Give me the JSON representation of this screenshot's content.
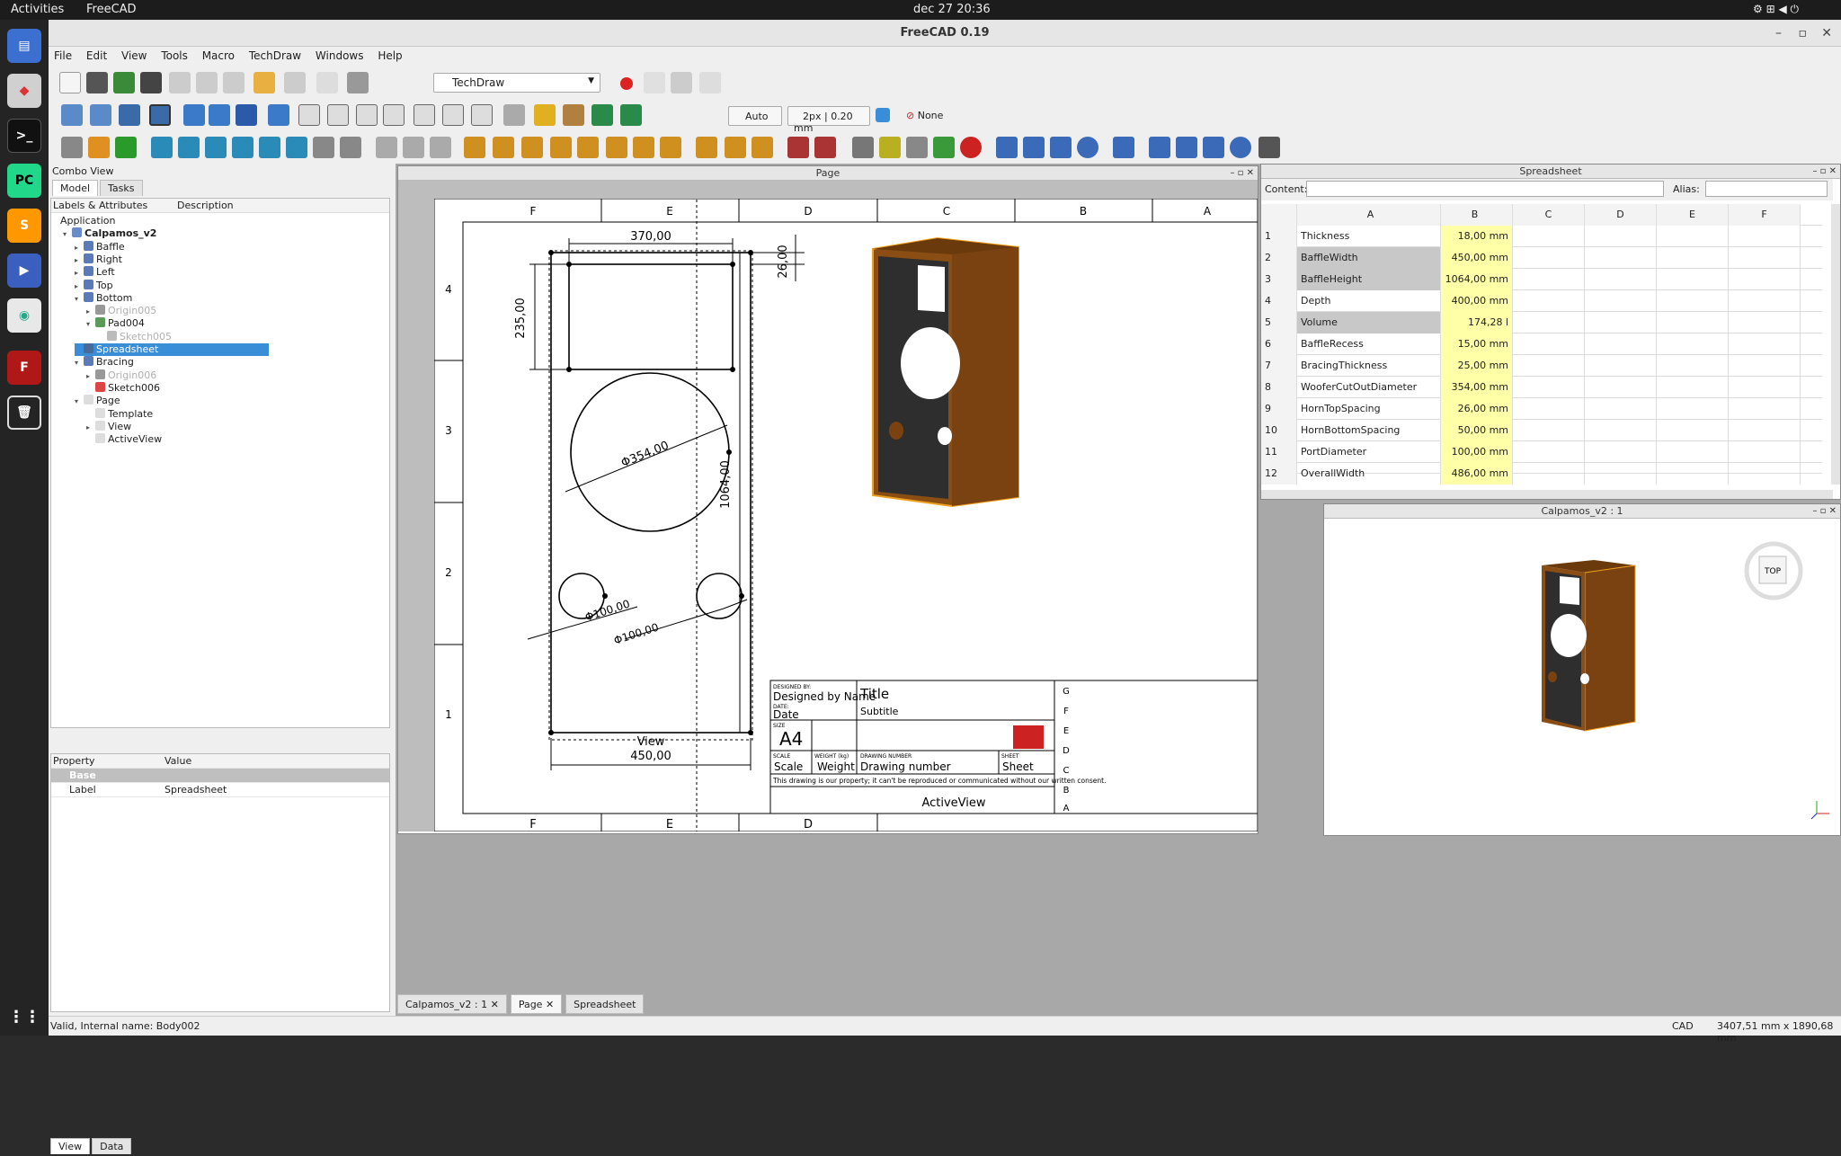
{
  "system": {
    "activities": "Activities",
    "app_name": "FreeCAD",
    "clock": "dec 27  20:36"
  },
  "window": {
    "title": "FreeCAD 0.19"
  },
  "menu": [
    "File",
    "Edit",
    "View",
    "Tools",
    "Macro",
    "TechDraw",
    "Windows",
    "Help"
  ],
  "toolbar": {
    "workbench": "TechDraw",
    "auto_label": "Auto",
    "line_width": "2px | 0.20 mm",
    "none_label": "None"
  },
  "combo": {
    "title": "Combo View",
    "tabs": [
      "Model",
      "Tasks"
    ],
    "columns": [
      "Labels & Attributes",
      "Description"
    ],
    "tree": [
      {
        "label": "Application",
        "level": 0,
        "arrow": "",
        "icon": "",
        "state": ""
      },
      {
        "label": "Calpamos_v2",
        "level": 1,
        "arrow": "▾",
        "icon": "#6a8ac8",
        "state": "bold"
      },
      {
        "label": "Baffle",
        "level": 2,
        "arrow": "▸",
        "icon": "#5a7ab8",
        "state": ""
      },
      {
        "label": "Right",
        "level": 2,
        "arrow": "▸",
        "icon": "#5a7ab8",
        "state": ""
      },
      {
        "label": "Left",
        "level": 2,
        "arrow": "▸",
        "icon": "#5a7ab8",
        "state": ""
      },
      {
        "label": "Top",
        "level": 2,
        "arrow": "▸",
        "icon": "#5a7ab8",
        "state": ""
      },
      {
        "label": "Bottom",
        "level": 2,
        "arrow": "▾",
        "icon": "#5a7ab8",
        "state": ""
      },
      {
        "label": "Origin005",
        "level": 3,
        "arrow": "▸",
        "icon": "#999",
        "state": "dim"
      },
      {
        "label": "Pad004",
        "level": 3,
        "arrow": "▾",
        "icon": "#5a9a5a",
        "state": ""
      },
      {
        "label": "Sketch005",
        "level": 4,
        "arrow": "",
        "icon": "#bbb",
        "state": "dim"
      },
      {
        "label": "Spreadsheet",
        "level": 2,
        "arrow": "",
        "icon": "#4a6a9a",
        "state": "sel"
      },
      {
        "label": "Bracing",
        "level": 2,
        "arrow": "▾",
        "icon": "#5a7ab8",
        "state": ""
      },
      {
        "label": "Origin006",
        "level": 3,
        "arrow": "▸",
        "icon": "#999",
        "state": "dim"
      },
      {
        "label": "Sketch006",
        "level": 3,
        "arrow": "",
        "icon": "#d44",
        "state": ""
      },
      {
        "label": "Page",
        "level": 2,
        "arrow": "▾",
        "icon": "#ddd",
        "state": ""
      },
      {
        "label": "Template",
        "level": 3,
        "arrow": "",
        "icon": "#ddd",
        "state": ""
      },
      {
        "label": "View",
        "level": 3,
        "arrow": "▸",
        "icon": "#ddd",
        "state": ""
      },
      {
        "label": "ActiveView",
        "level": 3,
        "arrow": "",
        "icon": "#ddd",
        "state": ""
      }
    ],
    "props_columns": [
      "Property",
      "Value"
    ],
    "props_group": "Base",
    "props": [
      {
        "name": "Label",
        "value": "Spreadsheet"
      }
    ],
    "bottom_tabs": [
      "View",
      "Data"
    ]
  },
  "page_window": {
    "title": "Page",
    "dims": {
      "top_width": "370,00",
      "height_235": "235,00",
      "top_offset": "26,00",
      "woofer": "Φ354,00",
      "height_total": "1064,00",
      "port1": "Φ100,00",
      "port2": "Φ100,00",
      "bottom_width": "450,00",
      "view_label": "View",
      "active_view": "ActiveView"
    },
    "zones_top": [
      "F",
      "E",
      "D",
      "C",
      "B",
      "A"
    ],
    "zones_side": [
      "4",
      "3",
      "2",
      "1"
    ],
    "title_block": {
      "designed_by_cap": "DESIGNED BY:",
      "designed_by": "Designed by Name",
      "date_cap": "DATE:",
      "date": "Date",
      "size_cap": "SIZE",
      "size": "A4",
      "title": "Title",
      "subtitle": "Subtitle",
      "scale_cap": "SCALE",
      "scale": "Scale",
      "weight_cap": "WEIGHT (kg)",
      "weight": "Weight",
      "drawing_cap": "DRAWING NUMBER",
      "drawing": "Drawing number",
      "sheet_cap": "SHEET",
      "sheet": "Sheet",
      "notice": "This drawing is our property; it can't be reproduced or communicated without our written consent.",
      "rows": [
        "G",
        "F",
        "E",
        "D",
        "C",
        "B",
        "A"
      ]
    }
  },
  "spreadsheet": {
    "title": "Spreadsheet",
    "content_label": "Content:",
    "alias_label": "Alias:",
    "columns": [
      "A",
      "B",
      "C",
      "D",
      "E",
      "F"
    ],
    "rows": [
      {
        "n": "1",
        "a": "Thickness",
        "b": "18,00 mm",
        "hl": false
      },
      {
        "n": "2",
        "a": "BaffleWidth",
        "b": "450,00 mm",
        "hl": true
      },
      {
        "n": "3",
        "a": "BaffleHeight",
        "b": "1064,00 mm",
        "hl": true
      },
      {
        "n": "4",
        "a": "Depth",
        "b": "400,00 mm",
        "hl": false
      },
      {
        "n": "5",
        "a": "Volume",
        "b": "174,28 l",
        "hl": true
      },
      {
        "n": "6",
        "a": "BaffleRecess",
        "b": "15,00 mm",
        "hl": false
      },
      {
        "n": "7",
        "a": "BracingThickness",
        "b": "25,00 mm",
        "hl": false
      },
      {
        "n": "8",
        "a": "WooferCutOutDiameter",
        "b": "354,00 mm",
        "hl": false
      },
      {
        "n": "9",
        "a": "HornTopSpacing",
        "b": "26,00 mm",
        "hl": false
      },
      {
        "n": "10",
        "a": "HornBottomSpacing",
        "b": "50,00 mm",
        "hl": false
      },
      {
        "n": "11",
        "a": "PortDiameter",
        "b": "100,00 mm",
        "hl": false
      },
      {
        "n": "12",
        "a": "OverallWidth",
        "b": "486,00 mm",
        "hl": false
      }
    ]
  },
  "view3d": {
    "title": "Calpamos_v2 : 1",
    "navcube": "TOP"
  },
  "doc_tabs": [
    "Calpamos_v2 : 1",
    "Page",
    "Spreadsheet"
  ],
  "status": {
    "left": "Valid, Internal name: Body002",
    "nav": "CAD",
    "dims": "3407,51 mm x 1890,68 mm"
  },
  "colors": {
    "accent": "#3a8ed8",
    "cabinet": "#7a4210",
    "cabinet_edge": "#f0a020",
    "baffle": "#2e2e2e",
    "cell_yellow": "#ffffa8"
  }
}
